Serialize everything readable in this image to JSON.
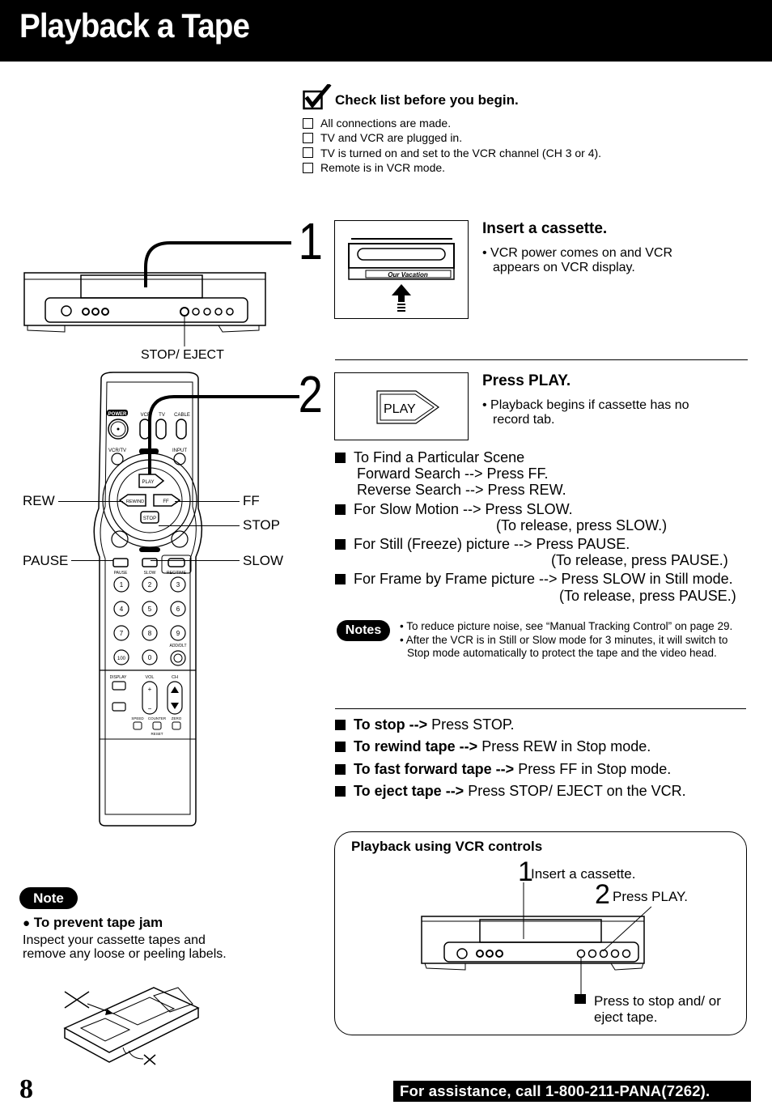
{
  "page": {
    "title": "Playback a Tape",
    "page_number": "8",
    "footer_assistance": "For assistance, call 1-800-211-PANA(7262)."
  },
  "checklist": {
    "heading": "Check list before you begin.",
    "items": [
      "All connections are made.",
      "TV and VCR are plugged in.",
      "TV is turned on and set to the VCR channel (CH 3 or 4).",
      "Remote is in VCR mode."
    ]
  },
  "diagram_labels": {
    "stop_eject": "STOP/ EJECT",
    "rew": "REW",
    "ff": "FF",
    "stop": "STOP",
    "pause": "PAUSE",
    "slow": "SLOW",
    "cassette_label": "Our Vacation",
    "play_button": "PLAY"
  },
  "remote_buttons": {
    "power": "POWER",
    "vcr": "VCR",
    "tv": "TV",
    "cable": "CABLE",
    "vcr_tv": "VCR/TV",
    "input": "INPUT",
    "play": "PLAY",
    "rewind": "REWIND",
    "ff": "FF",
    "stop": "STOP",
    "pause": "PAUSE",
    "slow": "SLOW",
    "rec_time": "REC/TIME",
    "digits": [
      "1",
      "2",
      "3",
      "4",
      "5",
      "6",
      "7",
      "8",
      "9",
      "100",
      "0"
    ],
    "add_dlt": "ADD/DLT",
    "display": "DISPLAY",
    "vol": "VOL",
    "ch": "CH",
    "speed": "SPEED",
    "counter": "COUNTER",
    "zero": "ZERO",
    "reset": "RESET",
    "vol_plus": "+",
    "vol_minus": "−"
  },
  "steps": [
    {
      "number": "1",
      "title": "Insert a cassette.",
      "description": "VCR power comes on and VCR appears on VCR display."
    },
    {
      "number": "2",
      "title": "Press PLAY.",
      "description": "Playback begins if cassette has no record tab."
    }
  ],
  "tips": [
    {
      "lines": [
        "To Find a Particular Scene",
        "Forward Search --> Press FF.",
        "Reverse Search --> Press REW."
      ]
    },
    {
      "lines": [
        "For Slow Motion --> Press SLOW.",
        "(To release, press SLOW.)"
      ]
    },
    {
      "lines": [
        "For Still (Freeze) picture --> Press PAUSE.",
        "(To release, press PAUSE.)"
      ]
    },
    {
      "lines": [
        "For Frame by Frame picture --> Press SLOW in Still mode.",
        "(To release, press PAUSE.)"
      ]
    }
  ],
  "notes": {
    "badge": "Notes",
    "items": [
      "To reduce picture noise, see “Manual Tracking Control” on page 29.",
      "After the VCR is in Still or Slow mode for 3 minutes, it will switch to Stop mode automatically to protect the tape and the video head."
    ]
  },
  "actions": [
    {
      "bold": "To stop -->",
      "text": " Press STOP."
    },
    {
      "bold": "To rewind tape -->",
      "text": " Press REW in Stop mode."
    },
    {
      "bold": "To fast forward tape -->",
      "text": " Press FF in Stop mode."
    },
    {
      "bold": "To eject tape -->",
      "text": " Press STOP/ EJECT on the VCR."
    }
  ],
  "vcr_controls_panel": {
    "heading": "Playback using VCR controls",
    "step1_num": "1",
    "step1_text": "Insert a cassette.",
    "step2_num": "2",
    "step2_text": "Press PLAY.",
    "stop_text_line1": "Press to stop and/ or",
    "stop_text_line2": "eject tape."
  },
  "tape_jam_note": {
    "badge": "Note",
    "heading": "To prevent tape jam",
    "text_line1": "Inspect your cassette tapes and",
    "text_line2": "remove any loose or peeling labels."
  }
}
